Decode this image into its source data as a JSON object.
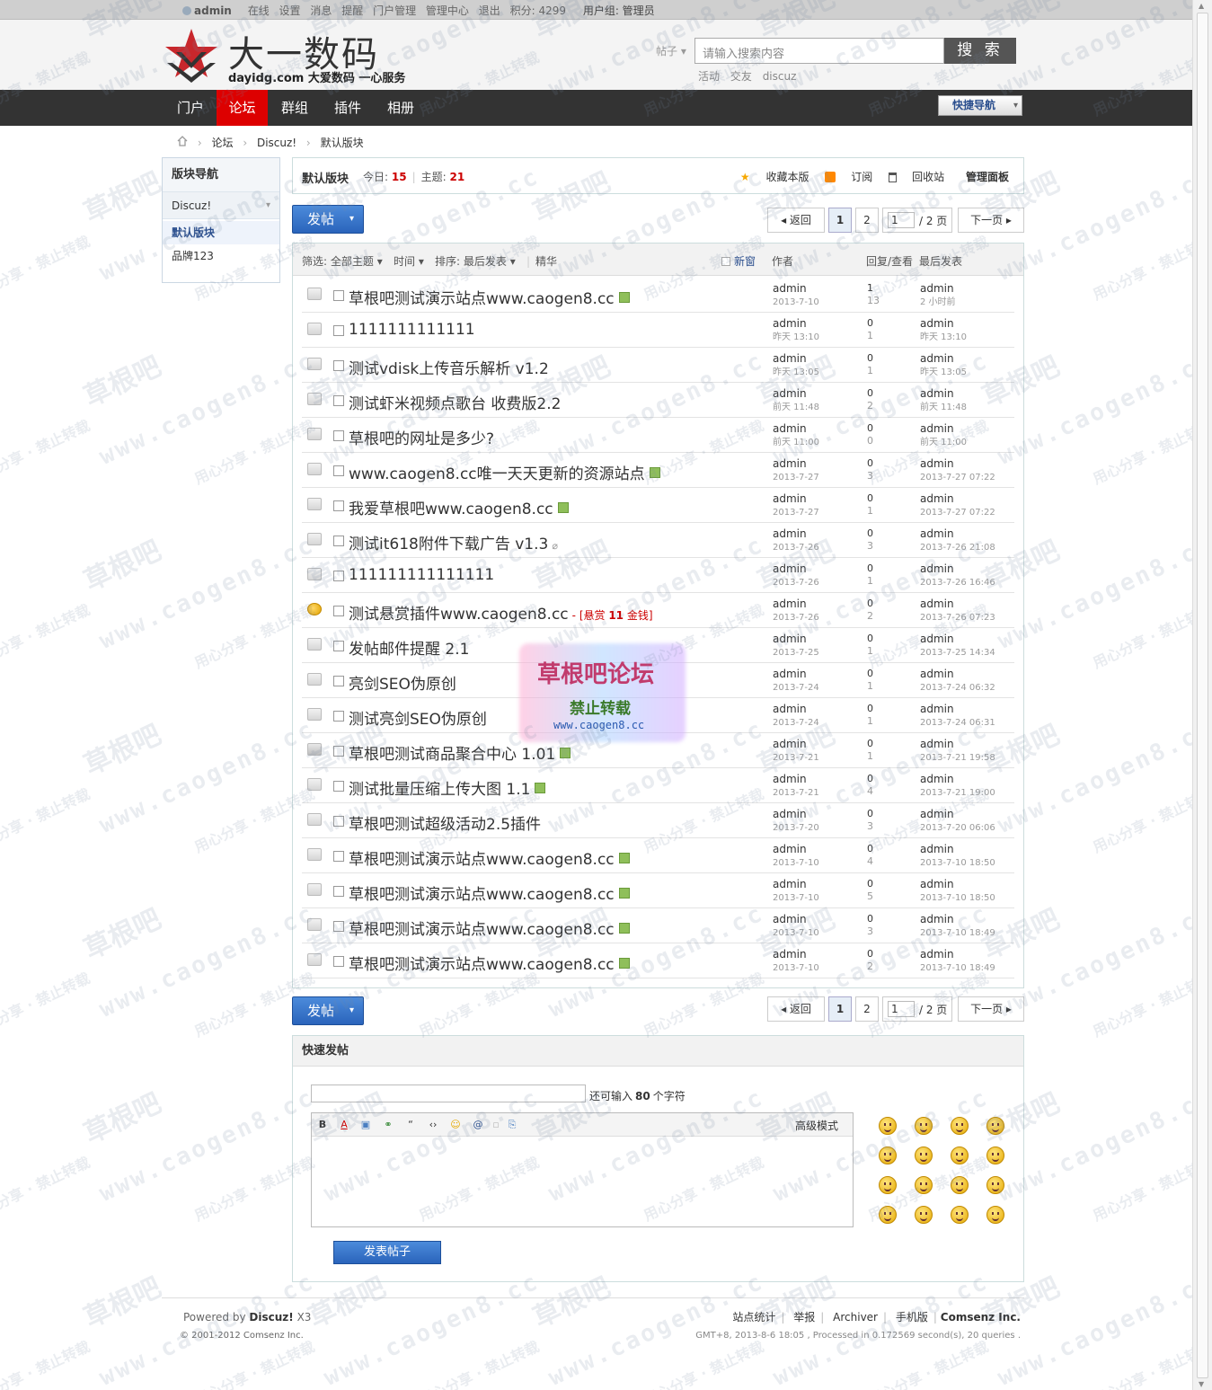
{
  "topbar": {
    "username": "admin",
    "links": [
      "在线",
      "设置",
      "消息",
      "提醒",
      "门户管理",
      "管理中心",
      "退出",
      "积分: 4299"
    ],
    "usergroup": "用户组: 管理员"
  },
  "logo": {
    "title": "大一数码",
    "subtitle": "dayidg.com 大爱数码 一心服务"
  },
  "search": {
    "type": "帖子",
    "placeholder": "请输入搜索内容",
    "button": "搜 索",
    "hot": [
      "活动",
      "交友",
      "discuz"
    ]
  },
  "nav": {
    "items": [
      "门户",
      "论坛",
      "群组",
      "插件",
      "相册"
    ],
    "active": "论坛",
    "quick_nav": "快捷导航"
  },
  "breadcrumb": [
    "论坛",
    "Discuz!",
    "默认版块"
  ],
  "sidebar": {
    "title": "版块导航",
    "group": "Discuz!",
    "current": "默认版块",
    "items": [
      "品牌123"
    ]
  },
  "forum": {
    "name": "默认版块",
    "today_label": "今日:",
    "today": "15",
    "threads_label": "主题:",
    "threads": "21",
    "actions": [
      "收藏本版",
      "订阅",
      "回收站",
      "管理面板"
    ]
  },
  "post_button": "发帖",
  "pager": {
    "back": "返回",
    "pages": [
      "1",
      "2"
    ],
    "current_input": "1",
    "total": "/ 2 页",
    "next": "下一页"
  },
  "filter": {
    "filter": "筛选: 全部主题",
    "time": "时间",
    "sort": "排序: 最后发表",
    "digest": "精华",
    "new_window": "新窗",
    "author_col": "作者",
    "replies_col": "回复/查看",
    "lastpost_col": "最后发表"
  },
  "threads": [
    {
      "title": "草根吧测试演示站点www.caogen8.cc",
      "icon": "image",
      "author": "admin",
      "date": "2013-7-10",
      "replies": "1",
      "views": "13",
      "last_author": "admin",
      "last_date": "2 小时前"
    },
    {
      "title": "1111111111111",
      "icon": "",
      "author": "admin",
      "date": "昨天 13:10",
      "replies": "0",
      "views": "1",
      "last_author": "admin",
      "last_date": "昨天 13:10"
    },
    {
      "title": "测试vdisk上传音乐解析  v1.2",
      "icon": "",
      "author": "admin",
      "date": "昨天 13:05",
      "replies": "0",
      "views": "1",
      "last_author": "admin",
      "last_date": "昨天 13:05"
    },
    {
      "title": "测试虾米视频点歌台  收费版2.2",
      "icon": "",
      "author": "admin",
      "date": "前天 11:48",
      "replies": "0",
      "views": "2",
      "last_author": "admin",
      "last_date": "前天 11:48"
    },
    {
      "title": "草根吧的网址是多少?",
      "icon": "",
      "author": "admin",
      "date": "前天 11:00",
      "replies": "0",
      "views": "0",
      "last_author": "admin",
      "last_date": "前天 11:00"
    },
    {
      "title": "www.caogen8.cc唯一天天更新的资源站点",
      "icon": "image",
      "author": "admin",
      "date": "2013-7-27",
      "replies": "0",
      "views": "3",
      "last_author": "admin",
      "last_date": "2013-7-27 07:22"
    },
    {
      "title": "我爱草根吧www.caogen8.cc",
      "icon": "image",
      "author": "admin",
      "date": "2013-7-27",
      "replies": "0",
      "views": "1",
      "last_author": "admin",
      "last_date": "2013-7-27 07:22"
    },
    {
      "title": "测试it618附件下载广告  v1.3",
      "icon": "attach",
      "author": "admin",
      "date": "2013-7-26",
      "replies": "0",
      "views": "3",
      "last_author": "admin",
      "last_date": "2013-7-26 21:08"
    },
    {
      "title": "111111111111111",
      "icon": "",
      "author": "admin",
      "date": "2013-7-26",
      "replies": "0",
      "views": "1",
      "last_author": "admin",
      "last_date": "2013-7-26 16:46"
    },
    {
      "title": "测试悬赏插件www.caogen8.cc",
      "icon": "",
      "reward": true,
      "author": "admin",
      "date": "2013-7-26",
      "replies": "0",
      "views": "2",
      "last_author": "admin",
      "last_date": "2013-7-26 07:23"
    },
    {
      "title": "发帖邮件提醒  2.1",
      "icon": "",
      "author": "admin",
      "date": "2013-7-25",
      "replies": "0",
      "views": "1",
      "last_author": "admin",
      "last_date": "2013-7-25 14:34"
    },
    {
      "title": "亮剑SEO伪原创",
      "icon": "",
      "author": "admin",
      "date": "2013-7-24",
      "replies": "0",
      "views": "1",
      "last_author": "admin",
      "last_date": "2013-7-24 06:32"
    },
    {
      "title": "测试亮剑SEO伪原创",
      "icon": "",
      "author": "admin",
      "date": "2013-7-24",
      "replies": "0",
      "views": "1",
      "last_author": "admin",
      "last_date": "2013-7-24 06:31"
    },
    {
      "title": "草根吧测试商品聚合中心  1.01",
      "icon": "image",
      "cart": true,
      "author": "admin",
      "date": "2013-7-21",
      "replies": "0",
      "views": "1",
      "last_author": "admin",
      "last_date": "2013-7-21 19:58"
    },
    {
      "title": "测试批量压缩上传大图  1.1",
      "icon": "image",
      "author": "admin",
      "date": "2013-7-21",
      "replies": "0",
      "views": "4",
      "last_author": "admin",
      "last_date": "2013-7-21 19:00"
    },
    {
      "title": "草根吧测试超级活动2.5插件",
      "icon": "",
      "author": "admin",
      "date": "2013-7-20",
      "replies": "0",
      "views": "3",
      "last_author": "admin",
      "last_date": "2013-7-20 06:06"
    },
    {
      "title": "草根吧测试演示站点www.caogen8.cc",
      "icon": "image",
      "author": "admin",
      "date": "2013-7-10",
      "replies": "0",
      "views": "4",
      "last_author": "admin",
      "last_date": "2013-7-10 18:50"
    },
    {
      "title": "草根吧测试演示站点www.caogen8.cc",
      "icon": "image",
      "author": "admin",
      "date": "2013-7-10",
      "replies": "0",
      "views": "5",
      "last_author": "admin",
      "last_date": "2013-7-10 18:50"
    },
    {
      "title": "草根吧测试演示站点www.caogen8.cc",
      "icon": "image",
      "author": "admin",
      "date": "2013-7-10",
      "replies": "0",
      "views": "3",
      "last_author": "admin",
      "last_date": "2013-7-10 18:49"
    },
    {
      "title": "草根吧测试演示站点www.caogen8.cc",
      "icon": "image",
      "author": "admin",
      "date": "2013-7-10",
      "replies": "0",
      "views": "2",
      "last_author": "admin",
      "last_date": "2013-7-10 18:49"
    }
  ],
  "reward": {
    "prefix": "- [悬赏",
    "amount": "11",
    "suffix": "金钱]"
  },
  "quick_post": {
    "title": "快速发帖",
    "remain_prefix": "还可输入",
    "remain_count": "80",
    "remain_suffix": "个字符",
    "toolbar": [
      "B",
      "A",
      "▣",
      "⚭",
      "“",
      "‹›",
      "☺",
      "@",
      "▫",
      "⎘"
    ],
    "advanced": "高级模式",
    "submit": "发表帖子"
  },
  "footer": {
    "powered_prefix": "Powered by",
    "powered_brand": "Discuz!",
    "powered_ver": "X3",
    "copyright": "© 2001-2012 Comsenz Inc.",
    "links": [
      "站点统计",
      "举报",
      "Archiver",
      "手机版"
    ],
    "company": "Comsenz Inc.",
    "gmt": "GMT+8, 2013-8-6 18:05 , Processed in 0.172569 second(s), 20 queries ."
  },
  "stamp": {
    "title": "草根吧论坛",
    "subtitle": "禁止转载",
    "url": "www.caogen8.cc"
  },
  "watermark": {
    "big": "草根吧",
    "small": "用心分享 · 禁止转载",
    "url": "www.caogen8.cc"
  },
  "colors": {
    "nav_bg": "#333333",
    "nav_active": "#dd0000",
    "post_button": "#2a64bb",
    "link_blue": "#2b4f8e",
    "stat_red": "#cc0000"
  }
}
